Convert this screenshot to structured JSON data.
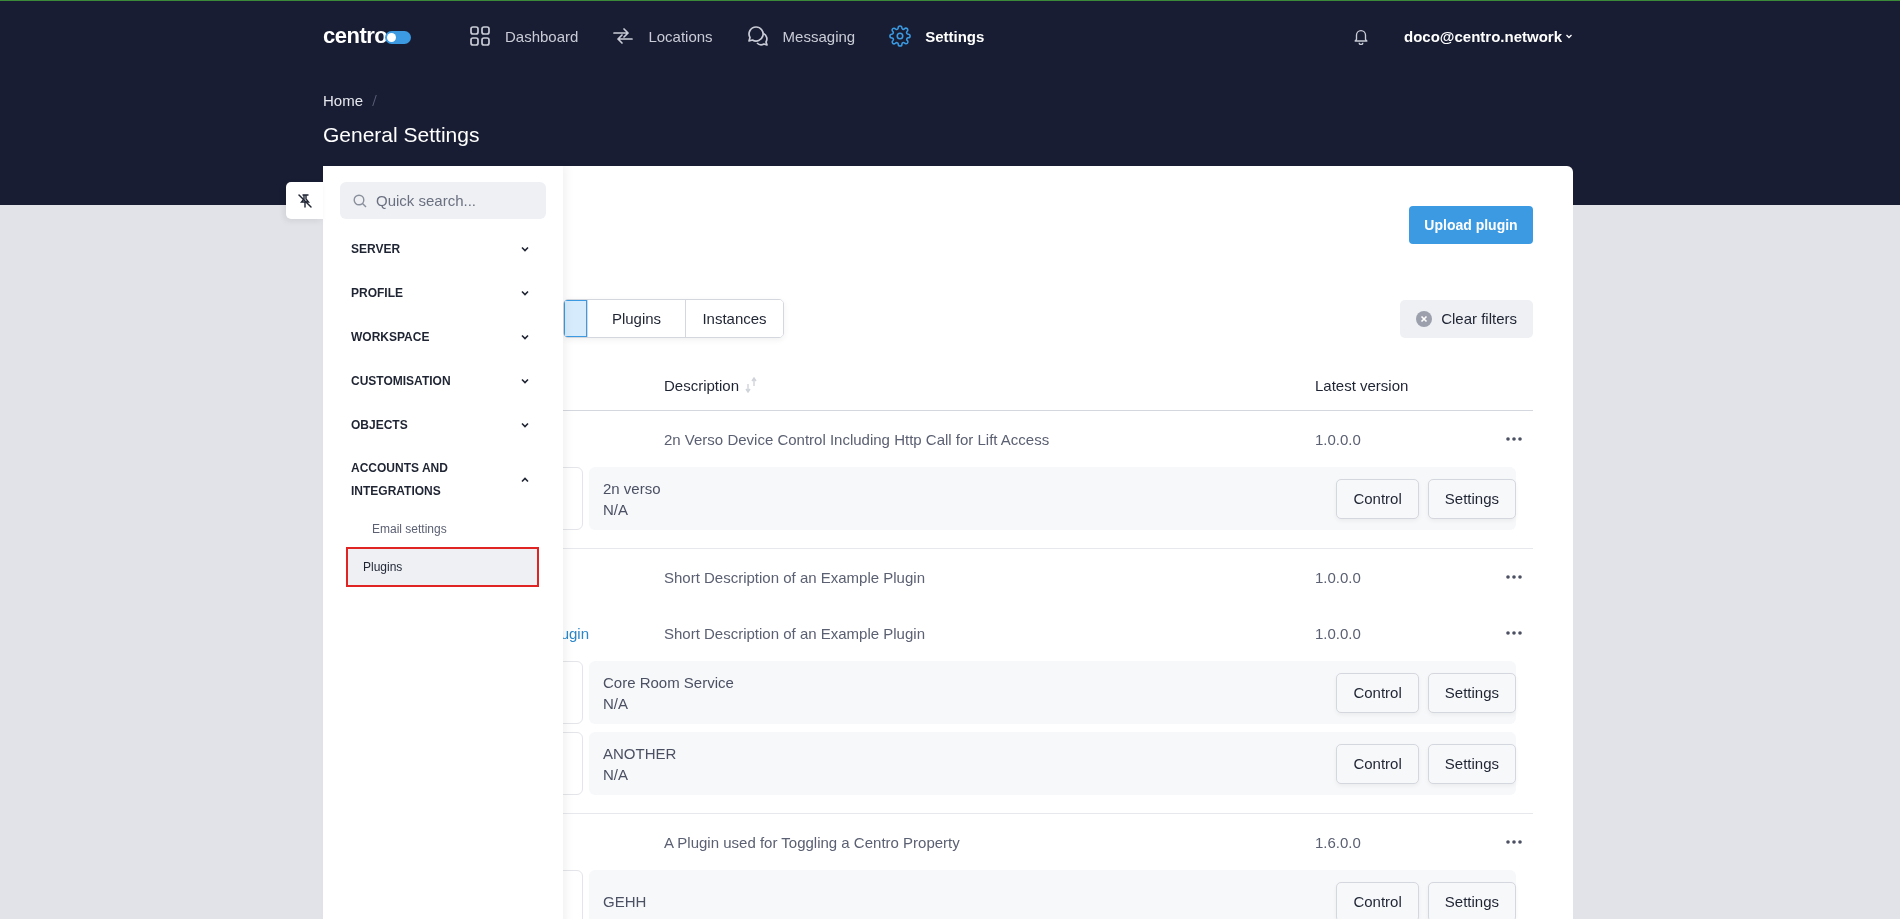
{
  "nav": {
    "logo": "centro",
    "items": [
      {
        "label": "Dashboard",
        "selected": false
      },
      {
        "label": "Locations",
        "selected": false
      },
      {
        "label": "Messaging",
        "selected": false
      },
      {
        "label": "Settings",
        "selected": true
      }
    ],
    "user": "doco@centro.network"
  },
  "breadcrumb": [
    "Home"
  ],
  "page_title": "General Settings",
  "sidebar": {
    "search_placeholder": "Quick search...",
    "sections": [
      {
        "label": "SERVER",
        "expanded": false
      },
      {
        "label": "PROFILE",
        "expanded": false
      },
      {
        "label": "WORKSPACE",
        "expanded": false
      },
      {
        "label": "CUSTOMISATION",
        "expanded": false
      },
      {
        "label": "OBJECTS",
        "expanded": false
      },
      {
        "label": "ACCOUNTS AND INTEGRATIONS",
        "expanded": true,
        "children": [
          {
            "label": "Email settings",
            "selected": false
          },
          {
            "label": "Plugins",
            "selected": true
          }
        ]
      }
    ]
  },
  "upload_button": "Upload plugin",
  "clear_filters": "Clear filters",
  "tabs": [
    {
      "selected": true
    },
    {
      "label": "Plugins",
      "selected": false
    },
    {
      "label": "Instances",
      "selected": false
    }
  ],
  "table": {
    "columns": [
      {
        "label": "Description",
        "sortable": true
      },
      {
        "label": "Latest version"
      }
    ],
    "groups": [
      {
        "plugins": [
          {
            "description": "2n Verso Device Control Including Http Call for Lift Access",
            "version": "1.0.0.0",
            "instances": [
              {
                "name": "2n verso",
                "status": "N/A",
                "buttons": [
                  "Control",
                  "Settings"
                ]
              }
            ]
          }
        ]
      },
      {
        "plugins": [
          {
            "description": "Short Description of an Example Plugin",
            "version": "1.0.0.0"
          },
          {
            "name": "ugin",
            "description": "Short Description of an Example Plugin",
            "version": "1.0.0.0",
            "instances": [
              {
                "name": "Core Room Service",
                "status": "N/A",
                "buttons": [
                  "Control",
                  "Settings"
                ]
              },
              {
                "name": "ANOTHER",
                "status": "N/A",
                "buttons": [
                  "Control",
                  "Settings"
                ]
              }
            ]
          }
        ]
      },
      {
        "plugins": [
          {
            "description": "A Plugin used for Toggling a Centro Property",
            "version": "1.6.0.0",
            "instances": [
              {
                "name": "GEHH",
                "buttons": [
                  "Control",
                  "Settings"
                ]
              }
            ]
          }
        ]
      }
    ]
  }
}
